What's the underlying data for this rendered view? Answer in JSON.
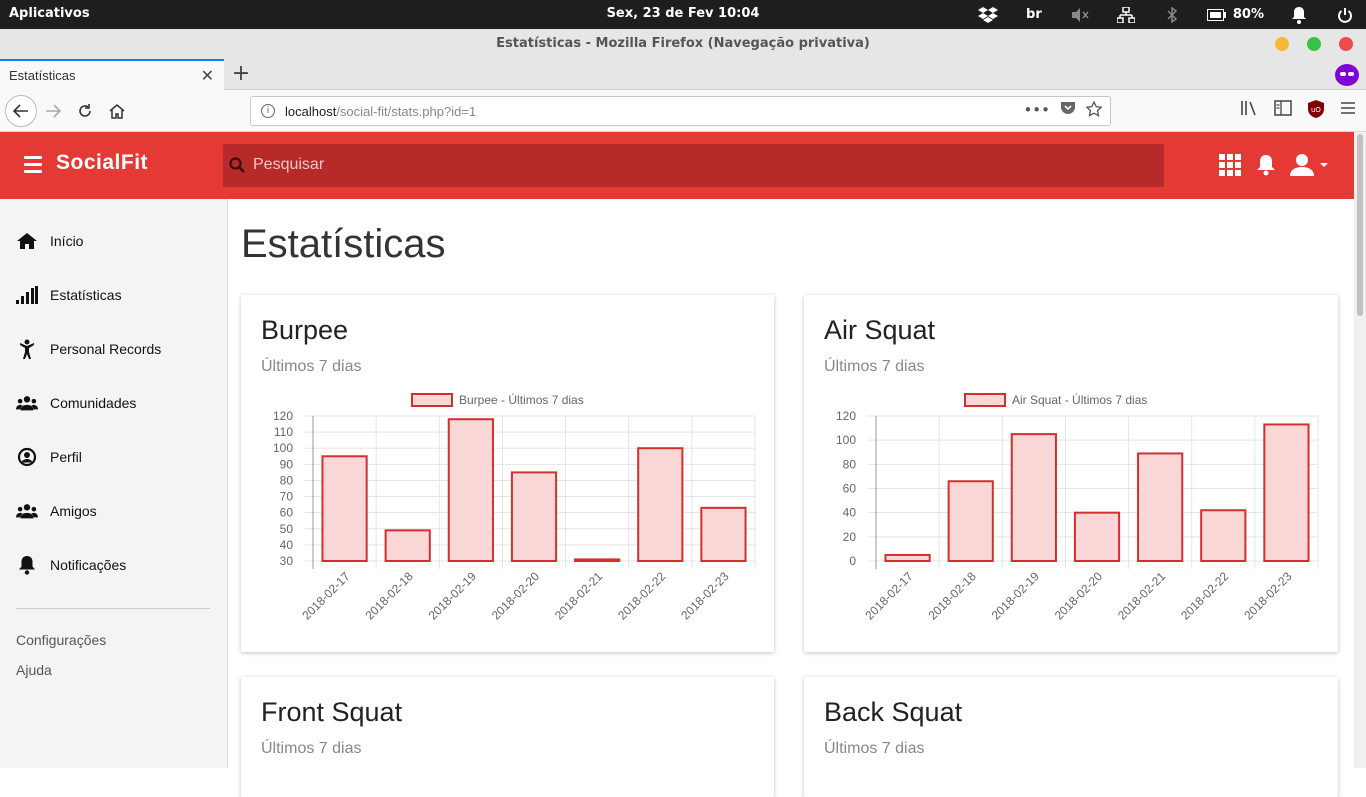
{
  "os": {
    "apps_label": "Aplicativos",
    "clock": "Sex, 23 de Fev    10:04",
    "keyboard_layout": "br",
    "battery": "80%"
  },
  "browser": {
    "window_title": "Estatísticas - Mozilla Firefox (Navegação privativa)",
    "tab_title": "Estatísticas",
    "url_host": "localhost",
    "url_path": "/social-fit/stats.php?id=1"
  },
  "app": {
    "brand": "SocialFit",
    "search_placeholder": "Pesquisar",
    "accent_color": "#e53935"
  },
  "sidebar": {
    "items": [
      {
        "label": "Início",
        "icon": "home-icon"
      },
      {
        "label": "Estatísticas",
        "icon": "stats-icon"
      },
      {
        "label": "Personal Records",
        "icon": "athlete-icon"
      },
      {
        "label": "Comunidades",
        "icon": "group-icon"
      },
      {
        "label": "Perfil",
        "icon": "profile-icon"
      },
      {
        "label": "Amigos",
        "icon": "friends-icon"
      },
      {
        "label": "Notificações",
        "icon": "bell-icon"
      }
    ],
    "links": [
      "Configurações",
      "Ajuda"
    ]
  },
  "page": {
    "title": "Estatísticas"
  },
  "cards": [
    {
      "title": "Burpee",
      "subtitle": "Últimos 7 dias"
    },
    {
      "title": "Air Squat",
      "subtitle": "Últimos 7 dias"
    },
    {
      "title": "Front Squat",
      "subtitle": "Últimos 7 dias"
    },
    {
      "title": "Back Squat",
      "subtitle": "Últimos 7 dias"
    }
  ],
  "chart_data": [
    {
      "type": "bar",
      "categories": [
        "2018-02-17",
        "2018-02-18",
        "2018-02-19",
        "2018-02-20",
        "2018-02-21",
        "2018-02-22",
        "2018-02-23"
      ],
      "series": [
        {
          "name": "Burpee - Últimos 7 dias",
          "values": [
            95,
            49,
            118,
            85,
            31,
            100,
            63
          ]
        }
      ],
      "ylim": [
        30,
        120
      ],
      "yticks": [
        30,
        40,
        50,
        60,
        70,
        80,
        90,
        100,
        110,
        120
      ],
      "grid": true,
      "legend": "top",
      "bar_fill": "#f9d7d7",
      "bar_stroke": "#d32f2f"
    },
    {
      "type": "bar",
      "categories": [
        "2018-02-17",
        "2018-02-18",
        "2018-02-19",
        "2018-02-20",
        "2018-02-21",
        "2018-02-22",
        "2018-02-23"
      ],
      "series": [
        {
          "name": "Air Squat - Últimos 7 dias",
          "values": [
            5,
            66,
            105,
            40,
            89,
            42,
            113
          ]
        }
      ],
      "ylim": [
        0,
        120
      ],
      "yticks": [
        0,
        20,
        40,
        60,
        80,
        100,
        120
      ],
      "grid": true,
      "legend": "top",
      "bar_fill": "#f9d7d7",
      "bar_stroke": "#d32f2f"
    }
  ]
}
